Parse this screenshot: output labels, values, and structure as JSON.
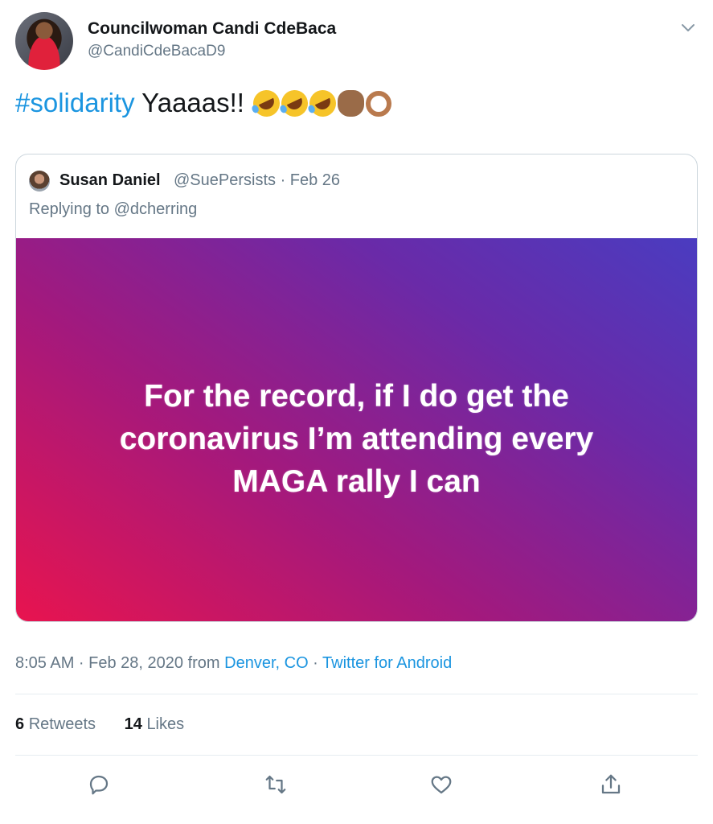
{
  "author": {
    "name": "Councilwoman Candi CdeBaca",
    "handle": "@CandiCdeBacaD9"
  },
  "tweet": {
    "hashtag": "#solidarity",
    "text": " Yaaaas!! ",
    "emoji": [
      "rolling-on-floor-laughing",
      "rolling-on-floor-laughing",
      "rolling-on-floor-laughing",
      "raised-fist-medium-dark",
      "ok-hand-medium-dark"
    ]
  },
  "quoted_tweet": {
    "name": "Susan Daniel",
    "handle_date": "@SuePersists · Feb 26",
    "replying_to": "Replying to @dcherring",
    "image_text": {
      "line1": "For the record, if I do get the",
      "line2": "coronavirus I’m attending every",
      "line3": "MAGA rally I can"
    }
  },
  "meta": {
    "time_date": "8:05 AM · Feb 28, 2020 from ",
    "location": "Denver, CO",
    "separator": " · ",
    "source": "Twitter for Android"
  },
  "stats": {
    "retweets_count": "6",
    "retweets_label": "Retweets",
    "likes_count": "14",
    "likes_label": "Likes"
  },
  "actions": {
    "icons": [
      "reply-icon",
      "retweet-icon",
      "like-icon",
      "share-icon"
    ]
  },
  "colors": {
    "link": "#1b95e0",
    "secondary_text": "#657786",
    "gradient": [
      "#e8144f",
      "#a3197d",
      "#6a2aa8",
      "#4a3cc0"
    ]
  }
}
